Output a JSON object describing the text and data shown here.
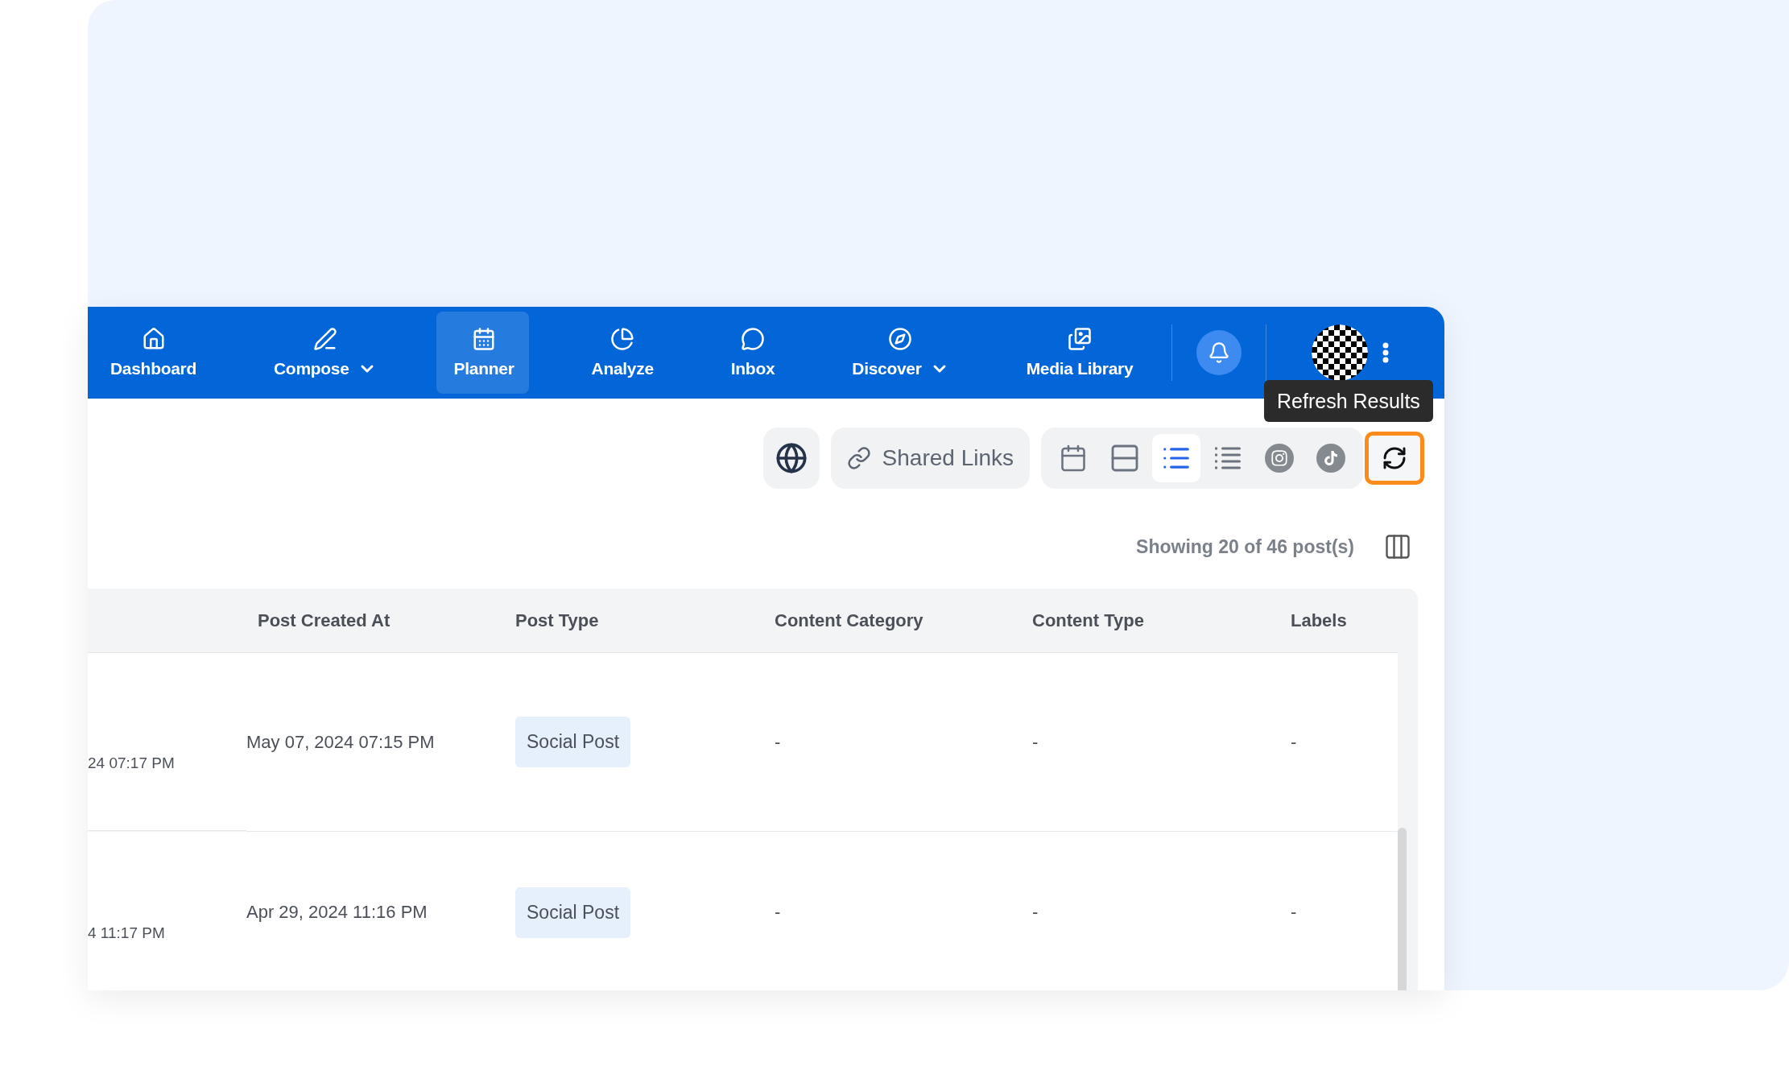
{
  "nav": {
    "items": [
      {
        "label": "Dashboard",
        "dropdown": false,
        "selected": false
      },
      {
        "label": "Compose",
        "dropdown": true,
        "selected": false
      },
      {
        "label": "Planner",
        "dropdown": false,
        "selected": true
      },
      {
        "label": "Analyze",
        "dropdown": false,
        "selected": false
      },
      {
        "label": "Inbox",
        "dropdown": false,
        "selected": false
      },
      {
        "label": "Discover",
        "dropdown": true,
        "selected": false
      },
      {
        "label": "Media Library",
        "dropdown": false,
        "selected": false
      }
    ]
  },
  "tooltip": "Refresh Results",
  "toolbar": {
    "shared_links": "Shared Links",
    "views": [
      {
        "kind": "calendar",
        "selected": false
      },
      {
        "kind": "rows",
        "selected": false
      },
      {
        "kind": "list",
        "selected": true
      },
      {
        "kind": "dotted-list",
        "selected": false
      },
      {
        "kind": "instagram",
        "selected": false
      },
      {
        "kind": "tiktok",
        "selected": false
      }
    ],
    "refresh_focused": true
  },
  "summary": "Showing 20 of 46 post(s)",
  "table": {
    "columns": [
      "Post Created At",
      "Post Type",
      "Content Category",
      "Content Type",
      "Labels"
    ],
    "rows": [
      {
        "column_1": "24 07:17 PM",
        "created": "May 07, 2024 07:15 PM",
        "post_type": "Social Post",
        "content_category": "-",
        "content_type": "-",
        "labels": "-"
      },
      {
        "column_1": "4 11:17 PM",
        "created": "Apr 29, 2024 11:16 PM",
        "post_type": "Social Post",
        "content_category": "-",
        "content_type": "-",
        "labels": "-"
      }
    ]
  }
}
